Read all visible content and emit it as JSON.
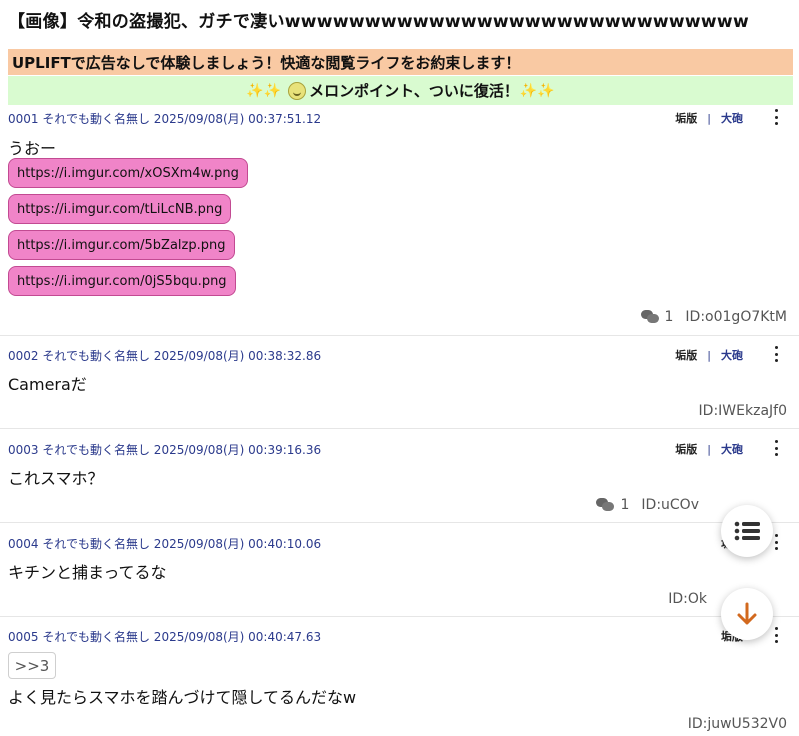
{
  "thread_title": "【画像】令和の盗撮犯、ガチで凄いwwwwwwwwwwwwwwwwwwwwwwwwwwwww",
  "banner_ad": "UPLIFTで広告なしで体験しましょう！快適な閲覧ライフをお約束します！",
  "banner_melon": "メロンポイント、ついに復活！",
  "actions": {
    "board": "垢版",
    "separator": "|",
    "report": "大砲"
  },
  "posts": [
    {
      "header": "0001 それでも動く名無し 2025/09/08(月) 00:37:51.12",
      "body": "うおー",
      "links": [
        "https://i.imgur.com/xOSXm4w.png",
        "https://i.imgur.com/tLiLcNB.png",
        "https://i.imgur.com/5bZalzp.png",
        "https://i.imgur.com/0jS5bqu.png"
      ],
      "reply_count": "1",
      "id": "ID:o01gO7KtM"
    },
    {
      "header": "0002 それでも動く名無し 2025/09/08(月) 00:38:32.86",
      "body": "Cameraだ",
      "id": "ID:IWEkzaJf0"
    },
    {
      "header": "0003 それでも動く名無し 2025/09/08(月) 00:39:16.36",
      "body": "これスマホ？",
      "reply_count": "1",
      "id": "ID:uCOv"
    },
    {
      "header": "0004 それでも動く名無し 2025/09/08(月) 00:40:10.06",
      "body": "キチンと捕まってるな",
      "id": "ID:Ok"
    },
    {
      "header": "0005 それでも動く名無し 2025/09/08(月) 00:40:47.63",
      "anchor": ">>3",
      "body": "よく見たらスマホを踏んづけて隠してるんだなw",
      "id": "ID:juwU532V0"
    }
  ],
  "fab": {
    "list_icon": "list-icon",
    "down_icon": "arrow-down-icon",
    "down_color": "#d2691e"
  }
}
